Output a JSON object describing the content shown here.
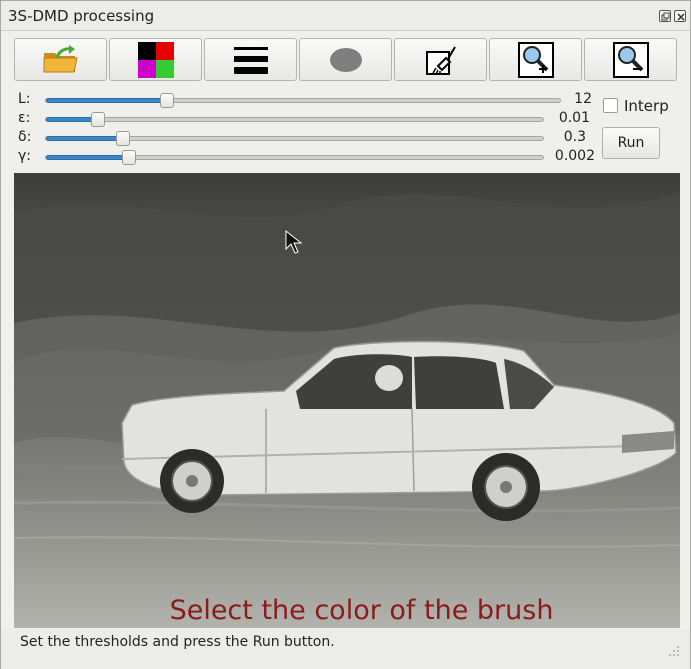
{
  "window": {
    "title": "3S-DMD processing",
    "float_icon": "float-window-icon",
    "close_icon": "close-window-icon"
  },
  "toolbar": {
    "buttons": [
      {
        "name": "open-file-button",
        "icon": "folder-open-icon"
      },
      {
        "name": "color-palette-button",
        "icon": "color-palette-icon"
      },
      {
        "name": "line-thickness-button",
        "icon": "line-thickness-icon"
      },
      {
        "name": "brush-shape-button",
        "icon": "ellipse-brush-icon"
      },
      {
        "name": "clear-canvas-button",
        "icon": "eraser-broom-icon"
      },
      {
        "name": "zoom-in-button",
        "icon": "zoom-in-icon"
      },
      {
        "name": "zoom-out-button",
        "icon": "zoom-out-icon"
      }
    ]
  },
  "sliders": [
    {
      "label": "L:",
      "value": "12",
      "level": 0.235
    },
    {
      "label": "ε:",
      "value": "0.01",
      "level": 0.105
    },
    {
      "label": "δ:",
      "value": "0.3",
      "level": 0.155
    },
    {
      "label": "γ:",
      "value": "0.002",
      "level": 0.168
    }
  ],
  "options": {
    "interp_label": "Interp",
    "interp_checked": false,
    "run_label": "Run"
  },
  "canvas": {
    "message": "Select the color of the brush",
    "message_color": "#8b1a1a"
  },
  "status": {
    "text": "Set the thresholds and press the Run button."
  },
  "colors": {
    "accent": "#3a86c7",
    "palette": [
      "#000000",
      "#e60000",
      "#cc00cc",
      "#33cc33"
    ]
  }
}
